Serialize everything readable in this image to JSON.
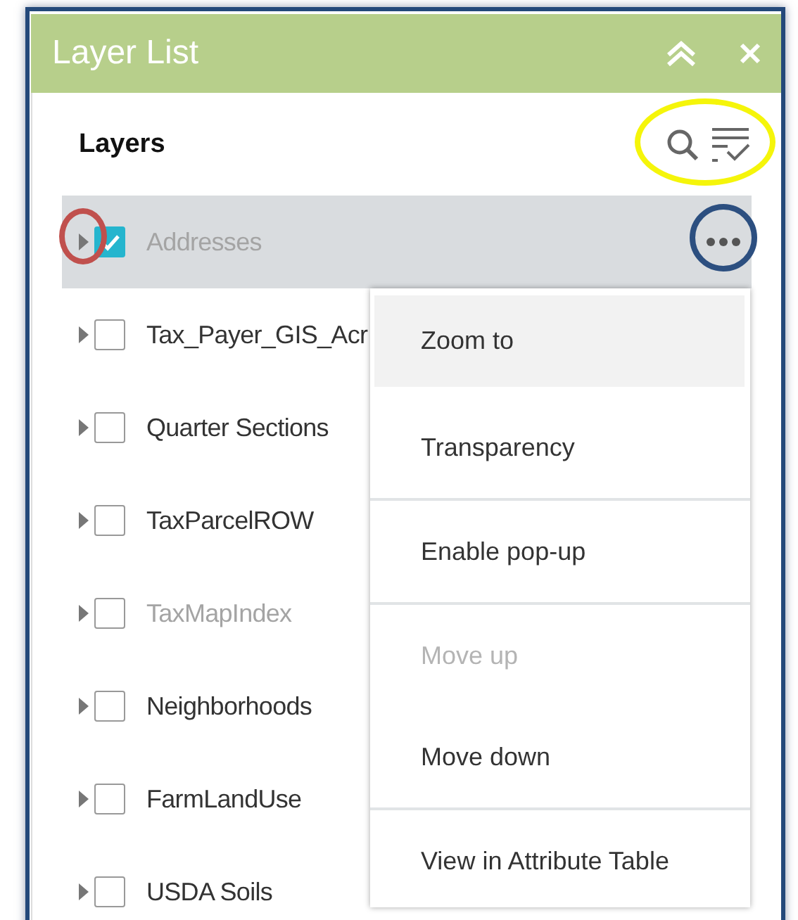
{
  "panel": {
    "title": "Layer List"
  },
  "section": {
    "title": "Layers",
    "tools_highlighted": true
  },
  "layers": [
    {
      "name": "Addresses",
      "checked": true,
      "selected": true,
      "dimmed": true,
      "expander_highlighted": true,
      "more_highlighted": true
    },
    {
      "name": "Tax_Payer_GIS_Acr",
      "checked": false,
      "selected": false,
      "dimmed": false,
      "expander_highlighted": false,
      "more_highlighted": false
    },
    {
      "name": "Quarter Sections",
      "checked": false,
      "selected": false,
      "dimmed": false,
      "expander_highlighted": false,
      "more_highlighted": false
    },
    {
      "name": "TaxParcelROW",
      "checked": false,
      "selected": false,
      "dimmed": false,
      "expander_highlighted": false,
      "more_highlighted": false
    },
    {
      "name": "TaxMapIndex",
      "checked": false,
      "selected": false,
      "dimmed": true,
      "expander_highlighted": false,
      "more_highlighted": false
    },
    {
      "name": "Neighborhoods",
      "checked": false,
      "selected": false,
      "dimmed": false,
      "expander_highlighted": false,
      "more_highlighted": false
    },
    {
      "name": "FarmLandUse",
      "checked": false,
      "selected": false,
      "dimmed": false,
      "expander_highlighted": false,
      "more_highlighted": false
    },
    {
      "name": "USDA Soils",
      "checked": false,
      "selected": false,
      "dimmed": false,
      "expander_highlighted": false,
      "more_highlighted": false
    }
  ],
  "context_menu": {
    "items": [
      {
        "label": "Zoom to",
        "hovered": true,
        "disabled": false,
        "divider_after": false
      },
      {
        "label": "Transparency",
        "hovered": false,
        "disabled": false,
        "divider_after": true
      },
      {
        "label": "Enable pop-up",
        "hovered": false,
        "disabled": false,
        "divider_after": true
      },
      {
        "label": "Move up",
        "hovered": false,
        "disabled": true,
        "divider_after": false
      },
      {
        "label": "Move down",
        "hovered": false,
        "disabled": false,
        "divider_after": true
      },
      {
        "label": "View in Attribute Table",
        "hovered": false,
        "disabled": false,
        "divider_after": false
      }
    ]
  }
}
